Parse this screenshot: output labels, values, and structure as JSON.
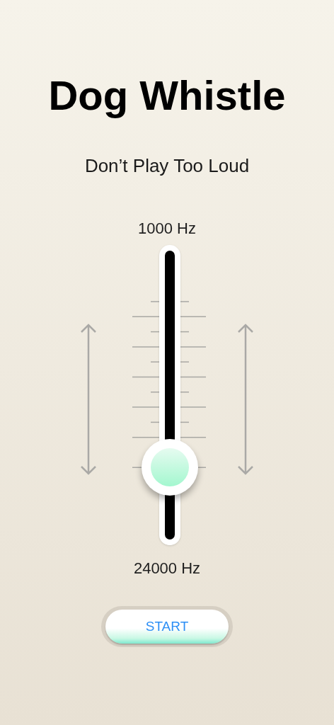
{
  "title": "Dog Whistle",
  "subtitle": "Don’t Play Too Loud",
  "slider": {
    "top_label": "1000 Hz",
    "bottom_label": "24000 Hz",
    "level": 0.26
  },
  "start_button": {
    "label": "START"
  }
}
